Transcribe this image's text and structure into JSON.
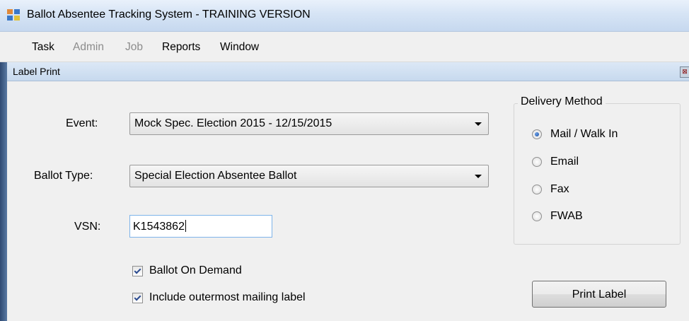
{
  "window": {
    "title": "Ballot Absentee Tracking System - TRAINING VERSION"
  },
  "menu": [
    {
      "label": "Task",
      "enabled": true
    },
    {
      "label": "Admin",
      "enabled": false
    },
    {
      "label": "Job",
      "enabled": false
    },
    {
      "label": "Reports",
      "enabled": true
    },
    {
      "label": "Window",
      "enabled": true
    }
  ],
  "dialog": {
    "title": "Label Print",
    "close_glyph": "⊠",
    "event": {
      "label": "Event:",
      "value": "Mock Spec. Election 2015 - 12/15/2015"
    },
    "ballot_type": {
      "label": "Ballot Type:",
      "value": "Special Election Absentee Ballot"
    },
    "vsn": {
      "label": "VSN:",
      "value": "K1543862"
    },
    "checkboxes": [
      {
        "label": "Ballot On Demand",
        "checked": true
      },
      {
        "label": "Include outermost mailing label",
        "checked": true
      }
    ],
    "delivery_method": {
      "title": "Delivery Method",
      "options": [
        {
          "label": "Mail / Walk In",
          "selected": true
        },
        {
          "label": "Email",
          "selected": false
        },
        {
          "label": "Fax",
          "selected": false
        },
        {
          "label": "FWAB",
          "selected": false
        }
      ]
    },
    "print_button": "Print Label"
  },
  "colors": {
    "titlebar": "#d6e4f5",
    "content_bg": "#f0f0f0",
    "radio_selected": "#1d4fa0"
  }
}
